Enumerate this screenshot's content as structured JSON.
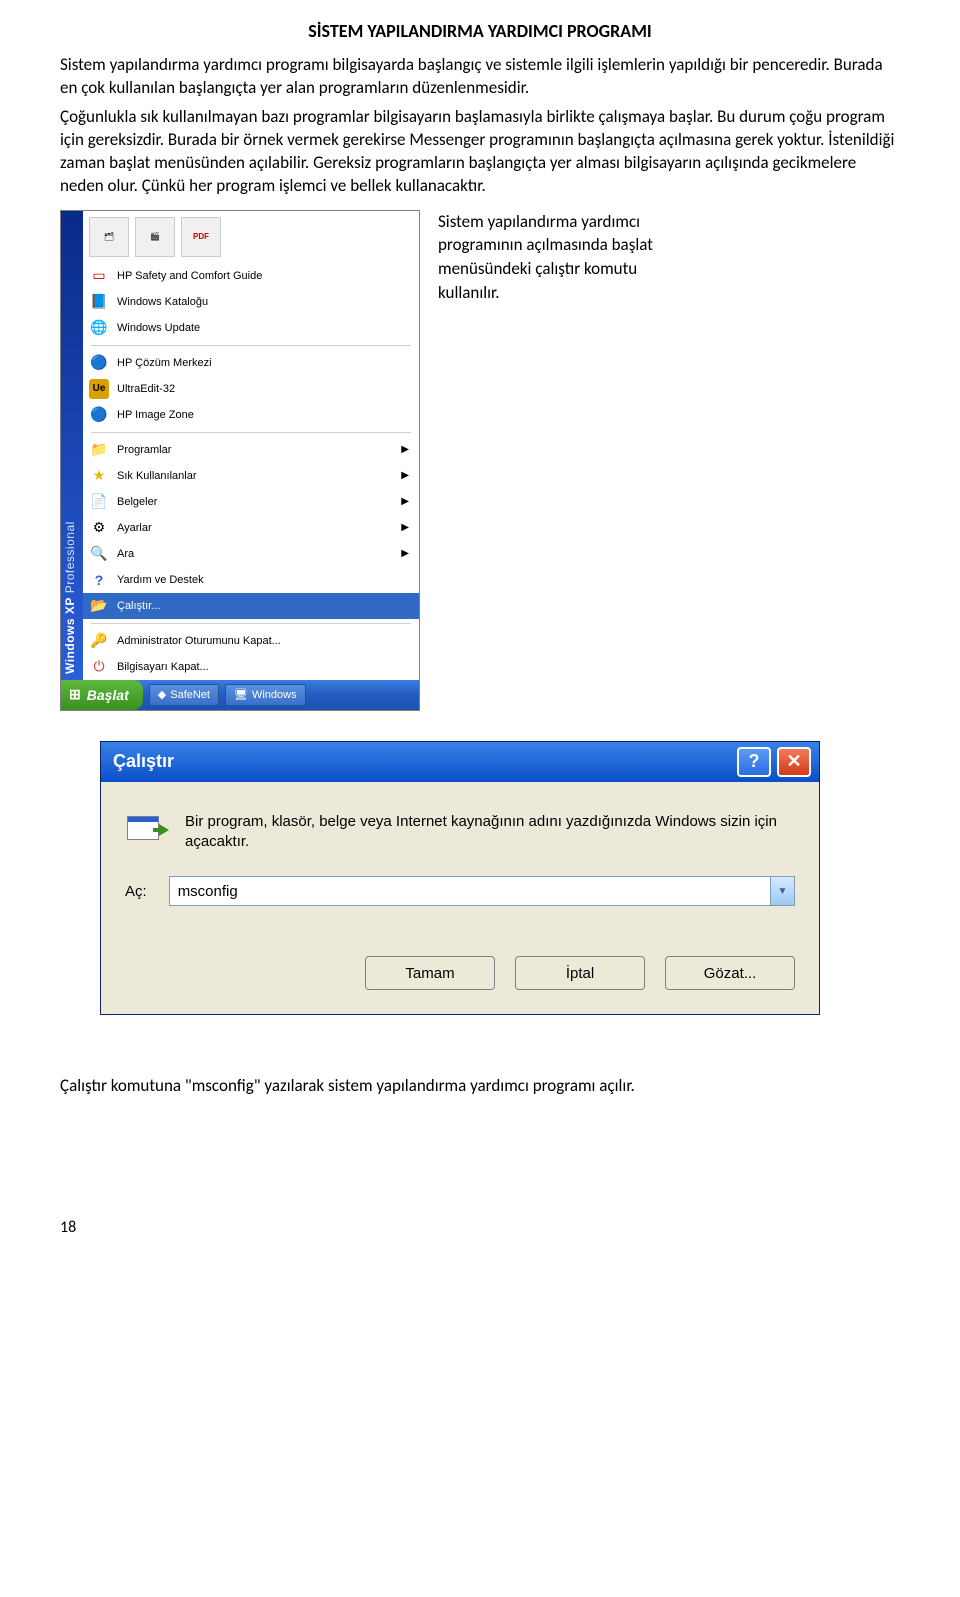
{
  "title": "SİSTEM YAPILANDIRMA YARDIMCI PROGRAMI",
  "para1": "Sistem yapılandırma yardımcı programı bilgisayarda başlangıç ve sistemle ilgili işlemlerin yapıldığı bir penceredir. Burada en çok kullanılan başlangıçta yer alan programların düzenlenmesidir.",
  "para2": "Çoğunlukla sık kullanılmayan bazı programlar bilgisayarın başlamasıyla birlikte çalışmaya başlar. Bu durum çoğu program için gereksizdir. Burada bir örnek vermek gerekirse Messenger programının başlangıçta açılmasına gerek yoktur. İstenildiği zaman başlat menüsünden açılabilir. Gereksiz programların başlangıçta yer alması bilgisayarın açılışında gecikmelere neden olur. Çünkü her program işlemci ve bellek kullanacaktır.",
  "side_caption": "Sistem yapılandırma yardımcı programının açılmasında başlat menüsündeki çalıştır komutu kullanılır.",
  "vertbar_bold": "Windows XP",
  "vertbar_light": "Professional",
  "start_label": "Başlat",
  "tb_item1": "SafeNet",
  "tb_item2": "Windows",
  "menu": {
    "hp_safety": "HP Safety and Comfort Guide",
    "win_catalog": "Windows Kataloğu",
    "win_update": "Windows Update",
    "hp_cozum": "HP Çözüm Merkezi",
    "ultraedit": "UltraEdit-32",
    "hp_image": "HP Image Zone",
    "programlar": "Programlar",
    "sik": "Sık Kullanılanlar",
    "belgeler": "Belgeler",
    "ayarlar": "Ayarlar",
    "ara": "Ara",
    "yardim": "Yardım ve Destek",
    "calistir": "Çalıştır...",
    "admin": "Administrator Oturumunu Kapat...",
    "kapat": "Bilgisayarı Kapat..."
  },
  "run": {
    "title": "Çalıştır",
    "desc": "Bir program, klasör, belge veya Internet kaynağının adını yazdığınızda Windows sizin için açacaktır.",
    "label": "Aç:",
    "value": "msconfig",
    "ok": "Tamam",
    "cancel": "İptal",
    "browse": "Gözat..."
  },
  "footer": "Çalıştır komutuna \"msconfig\" yazılarak sistem yapılandırma yardımcı programı açılır.",
  "page_num": "18"
}
